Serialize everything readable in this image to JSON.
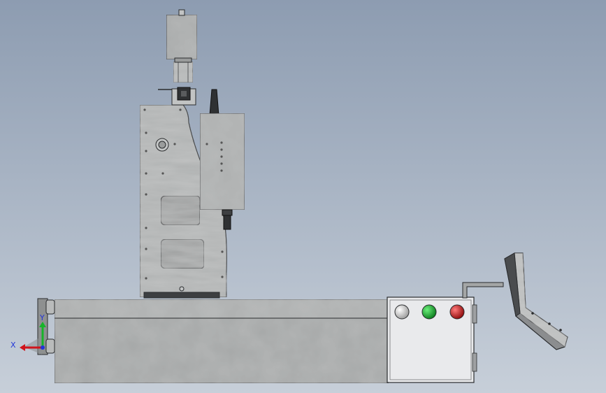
{
  "viewport": {
    "background_top": "#8d9cb1",
    "background_bottom": "#c7cfd9"
  },
  "machine": {
    "metal_base": "#a9abab",
    "metal_light": "#c6c8c8",
    "metal_dark": "#7e8282",
    "edge": "#2a2c2e",
    "dark_part": "#3d3f41",
    "control_panel_fill": "#e9eaec"
  },
  "control_panel": {
    "buttons": [
      {
        "name": "white-button",
        "color": "#f2f2f2"
      },
      {
        "name": "green-start-button",
        "color": "#11b02c"
      },
      {
        "name": "red-stop-button",
        "color": "#d61414"
      }
    ]
  },
  "triad": {
    "x_label": "X",
    "y_label": "Y",
    "x_color": "#d0141c",
    "y_color": "#17b42a",
    "z_color": "#2235d8"
  }
}
